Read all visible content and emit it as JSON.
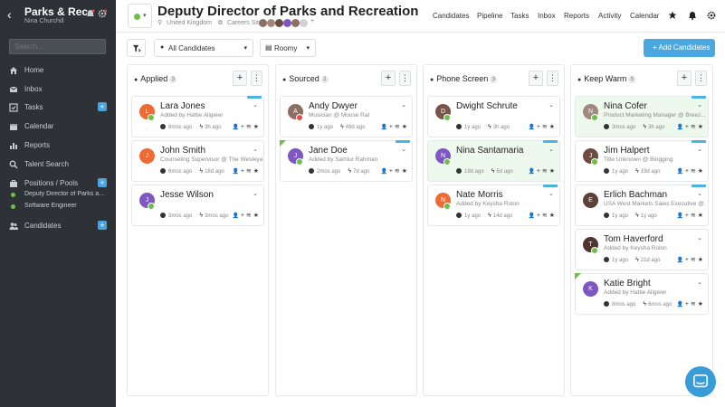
{
  "sidebar": {
    "app_title": "Parks & Rec",
    "user_name": "Nina Churchill",
    "search_placeholder": "Search...",
    "nav": [
      {
        "label": "Home",
        "icon": "home-icon"
      },
      {
        "label": "Inbox",
        "icon": "inbox-icon"
      },
      {
        "label": "Tasks",
        "icon": "tasks-icon"
      },
      {
        "label": "Calendar",
        "icon": "calendar-icon"
      },
      {
        "label": "Reports",
        "icon": "reports-icon"
      },
      {
        "label": "Talent Search",
        "icon": "search-icon"
      },
      {
        "label": "Positions / Pools",
        "icon": "briefcase-icon"
      },
      {
        "label": "Candidates",
        "icon": "people-icon"
      }
    ],
    "positions": [
      {
        "label": "Deputy Director of Parks and..."
      },
      {
        "label": "Software Engineer"
      }
    ]
  },
  "header": {
    "title": "Deputy Director of Parks and Recreation",
    "location": "United Kingdom",
    "site": "Careers Site",
    "nav": [
      "Candidates",
      "Pipeline",
      "Tasks",
      "Inbox",
      "Reports",
      "Activity",
      "Calendar"
    ]
  },
  "toolbar": {
    "candidates_filter": "All Candidates",
    "view_mode": "Roomy",
    "add_button": "Add Candidates"
  },
  "columns": [
    {
      "title": "Applied",
      "count": "3",
      "icon": "person-icon",
      "cards": [
        {
          "name": "Lara Jones",
          "sub": "Added by Hattie Aligeier",
          "age": "8mos ago",
          "activity": "3h ago",
          "avatar_letter": "L",
          "avatar_color": "#f06a35",
          "badge": "green",
          "tag": true,
          "highlight": false
        },
        {
          "name": "John Smith",
          "sub": "Counseling Supervisor @ The Wesleyan...",
          "age": "6mos ago",
          "activity": "18d ago",
          "avatar_letter": "J",
          "avatar_color": "#f06a35",
          "badge": "none",
          "tag": false,
          "highlight": false
        },
        {
          "name": "Jesse Wilson",
          "sub": "",
          "age": "3mos ago",
          "activity": "3mos ago",
          "avatar_letter": "J",
          "avatar_color": "#7e57c2",
          "badge": "green",
          "tag": false,
          "highlight": false
        }
      ]
    },
    {
      "title": "Sourced",
      "count": "2",
      "icon": "person-icon",
      "cards": [
        {
          "name": "Andy Dwyer",
          "sub": "Musician @ Mouse Rat",
          "age": "1y ago",
          "activity": "49d ago",
          "avatar_letter": "A",
          "avatar_color": "#8d6e63",
          "badge": "red",
          "tag": false,
          "highlight": false
        },
        {
          "name": "Jane Doe",
          "sub": "Added by Samiur Rahman",
          "age": "2mos ago",
          "activity": "7d ago",
          "avatar_letter": "J",
          "avatar_color": "#7e57c2",
          "badge": "green",
          "tag": true,
          "highlight": false
        }
      ]
    },
    {
      "title": "Phone Screen",
      "count": "3",
      "icon": "people-icon",
      "cards": [
        {
          "name": "Dwight Schrute",
          "sub": "",
          "age": "1y ago",
          "activity": "3h ago",
          "avatar_letter": "D",
          "avatar_color": "#795548",
          "badge": "green",
          "tag": false,
          "highlight": false
        },
        {
          "name": "Nina Santamaria",
          "sub": "",
          "age": "19d ago",
          "activity": "5d ago",
          "avatar_letter": "N",
          "avatar_color": "#7e57c2",
          "badge": "green",
          "tag": true,
          "highlight": true
        },
        {
          "name": "Nate Morris",
          "sub": "Added by Keysha Rolon",
          "age": "1y ago",
          "activity": "14d ago",
          "avatar_letter": "N",
          "avatar_color": "#f06a35",
          "badge": "green",
          "tag": true,
          "highlight": false
        }
      ]
    },
    {
      "title": "Keep Warm",
      "count": "5",
      "icon": "list-icon",
      "cards": [
        {
          "name": "Nina Cofer",
          "sub": "Product Marketing Manager @ Breez...",
          "age": "3mos ago",
          "activity": "3h ago",
          "avatar_letter": "N",
          "avatar_color": "#a1887f",
          "badge": "green",
          "tag": true,
          "highlight": true
        },
        {
          "name": "Jim Halpert",
          "sub": "Title Unknown @ Blogging",
          "age": "1y ago",
          "activity": "19d ago",
          "avatar_letter": "J",
          "avatar_color": "#6d4c41",
          "badge": "green",
          "tag": true,
          "highlight": false
        },
        {
          "name": "Erlich Bachman",
          "sub": "USA West Markets Sales Executive @...",
          "age": "1y ago",
          "activity": "1y ago",
          "avatar_letter": "E",
          "avatar_color": "#5d4037",
          "badge": "none",
          "tag": true,
          "highlight": false
        },
        {
          "name": "Tom Haverford",
          "sub": "Added by Keysha Rolon",
          "age": "1y ago",
          "activity": "21d ago",
          "avatar_letter": "T",
          "avatar_color": "#4e342e",
          "badge": "green",
          "tag": false,
          "highlight": false
        },
        {
          "name": "Katie Bright",
          "sub": "Added by Hattie Aligeier",
          "age": "8mos ago",
          "activity": "6mos ago",
          "avatar_letter": "K",
          "avatar_color": "#7e57c2",
          "badge": "none",
          "tag": false,
          "highlight": false
        }
      ]
    }
  ]
}
